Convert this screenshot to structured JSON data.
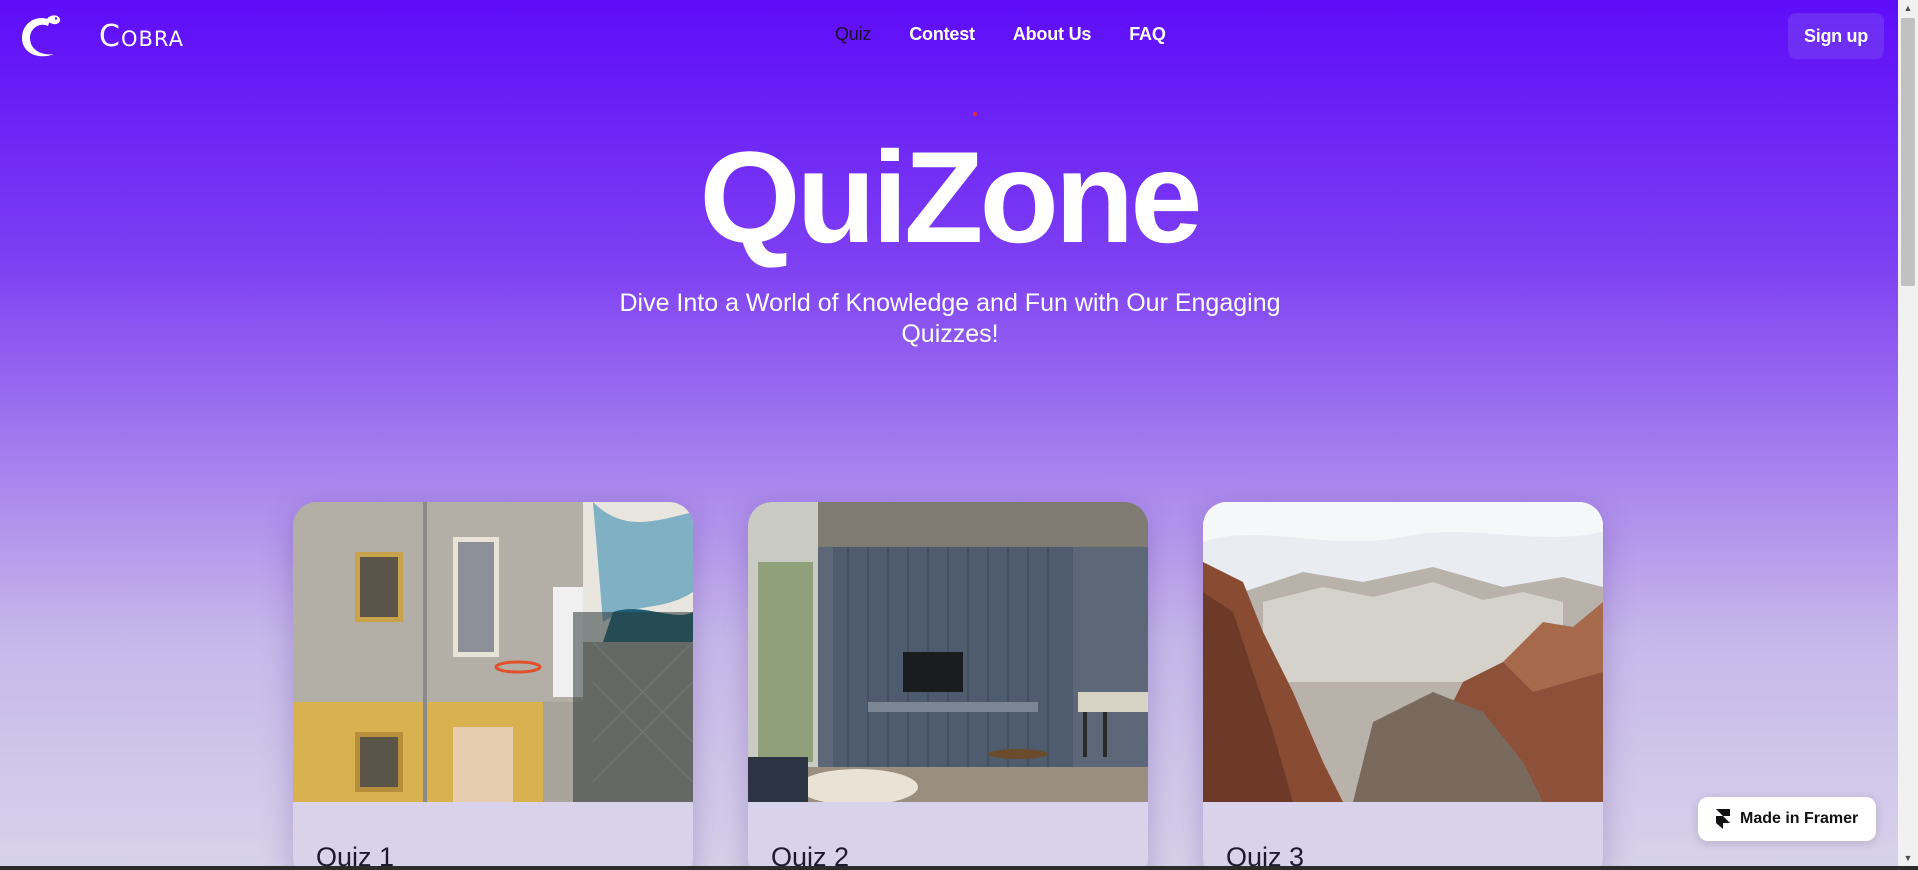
{
  "brand": {
    "name": "Cobra",
    "icon": "snake-logo-icon"
  },
  "nav": {
    "items": [
      {
        "label": "Quiz",
        "active": true
      },
      {
        "label": "Contest",
        "active": false
      },
      {
        "label": "About Us",
        "active": false
      },
      {
        "label": "FAQ",
        "active": false
      }
    ]
  },
  "header": {
    "signup_label": "Sign up"
  },
  "hero": {
    "title": "QuiZone",
    "subtitle": "Dive Into a World of Knowledge and Fun with Our Engaging Quizzes!"
  },
  "cards": [
    {
      "title": "Quiz 1",
      "image": "courtyard-basketball-photo"
    },
    {
      "title": "Quiz 2",
      "image": "modern-living-room-photo"
    },
    {
      "title": "Quiz 3",
      "image": "canyon-landscape-photo"
    }
  ],
  "badge": {
    "label": "Made in Framer",
    "icon": "framer-icon"
  },
  "colors": {
    "primary": "#5e0cf9",
    "gradient_end": "#d7d2ea",
    "card_body": "#d8d2ea",
    "text_dark": "#1e1a2e"
  }
}
